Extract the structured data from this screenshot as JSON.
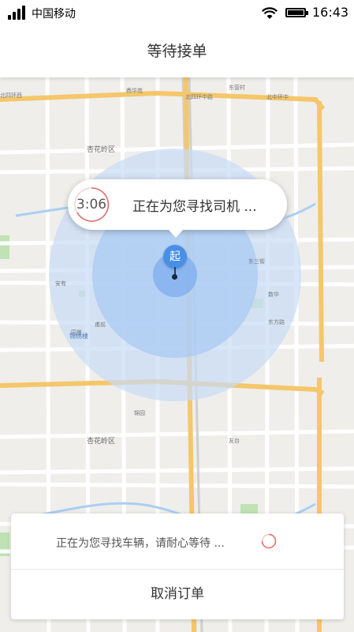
{
  "status_bar": {
    "carrier": "中国移动",
    "time": "16:43",
    "icons": [
      "signal-icon",
      "wifi-icon",
      "battery-icon"
    ]
  },
  "nav": {
    "title": "等待接单"
  },
  "map": {
    "labels": {
      "north_fourth_ring_west": "北四环西",
      "north_fourth_ring_middle": "北四环中路",
      "north_fourth_ring_mid2": "北中环中",
      "east_area_1": "东营村",
      "east_area_2": "鼎华苑",
      "xinghua": "杏花岭区",
      "xinghua2": "杏花岭区",
      "east_road_label": "东方路",
      "anyou": "安有",
      "shiji": "数华",
      "yuangui": "园景",
      "fuqian": "甫前",
      "dongsan": "东三街",
      "jingyuan": "锦园",
      "youtai": "友台"
    },
    "poi": "锦绣楼"
  },
  "bubble": {
    "countdown": "3:06",
    "text": "正在为您寻找司机 ..."
  },
  "marker": {
    "label": "起"
  },
  "card": {
    "message": "正在为您寻找车辆，请耐心等待 ...",
    "cancel_label": "取消订单"
  },
  "colors": {
    "accent_blue": "#4a8fe7",
    "radius_fill": "#bcd6f5",
    "road_yellow": "#f5c76a",
    "countdown_ring": "#e56a6a"
  }
}
